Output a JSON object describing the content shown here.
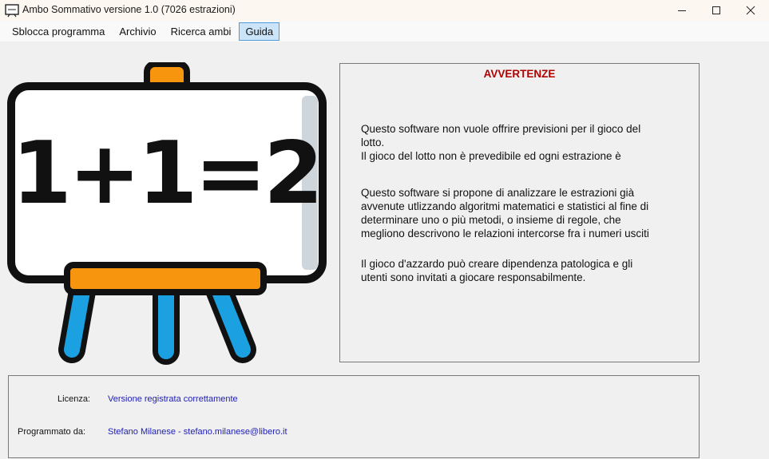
{
  "window": {
    "title": "Ambo Sommativo versione 1.0 (7026 estrazioni)",
    "controls": [
      "minimize-icon",
      "maximize-icon",
      "close-icon"
    ]
  },
  "menu": {
    "items": [
      "Sblocca programma",
      "Archivio",
      "Ricerca ambi",
      "Guida"
    ],
    "active": "Guida"
  },
  "illustration": {
    "equation": "1+1=2"
  },
  "warnings": {
    "title": "AVVERTENZE",
    "paragraphs": [
      "Questo software non vuole offrire previsioni per il gioco del\nlotto.\nIl gioco del lotto non è prevedibile ed ogni estrazione è",
      "Questo software si propone di analizzare le estrazioni già\navvenute utlizzando algoritmi matematici e statistici al fine di\ndeterminare  uno o più metodi, o insieme di regole, che\nmegliono descrivono le relazioni intercorse fra i numeri usciti",
      "Il gioco d'azzardo può creare dipendenza patologica e gli\nutenti sono invitati a giocare responsabilmente."
    ]
  },
  "info": {
    "license_label": "Licenza:",
    "license_value": "Versione registrata correttamente",
    "author_label": "Programmato da:",
    "author_value": "Stefano Milanese - stefano.milanese@libero.it"
  },
  "colors": {
    "warning_title": "#b00000",
    "link_text": "#1d1db5",
    "board_frame": "#111111",
    "board_tray": "#f7960e",
    "easel_legs": "#1ba1e2"
  }
}
